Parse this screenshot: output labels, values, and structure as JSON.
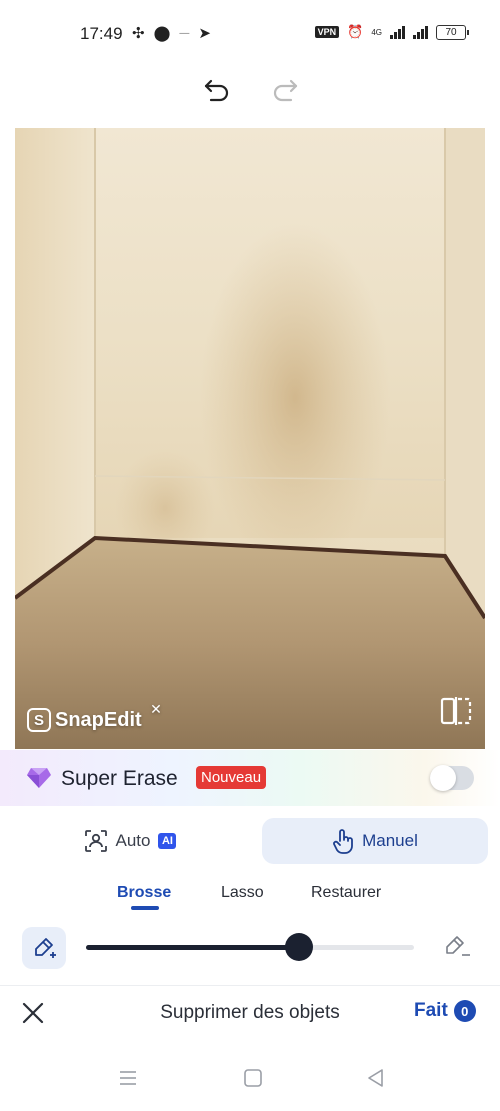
{
  "status_bar": {
    "time": "17:49",
    "vpn_label": "VPN",
    "network": "4G",
    "battery": "70"
  },
  "toolbar": {
    "undo_icon": "undo-icon",
    "redo_icon": "redo-icon"
  },
  "photo": {
    "watermark_text": "SnapEdit",
    "watermark_logo": "S"
  },
  "super_erase": {
    "label": "Super Erase",
    "badge": "Nouveau",
    "enabled": false
  },
  "modes": {
    "auto_label": "Auto",
    "auto_badge": "AI",
    "manual_label": "Manuel",
    "selected": "Manuel"
  },
  "tools": {
    "items": [
      "Brosse",
      "Lasso",
      "Restaurer"
    ],
    "selected": "Brosse"
  },
  "brush": {
    "size_fraction": 0.65
  },
  "action_bar": {
    "title": "Supprimer des objets",
    "done_label": "Fait",
    "done_count": "0"
  },
  "colors": {
    "accent": "#1e4bb3",
    "badge_red": "#e53935",
    "selected_tab_bg": "#e8eef9"
  }
}
